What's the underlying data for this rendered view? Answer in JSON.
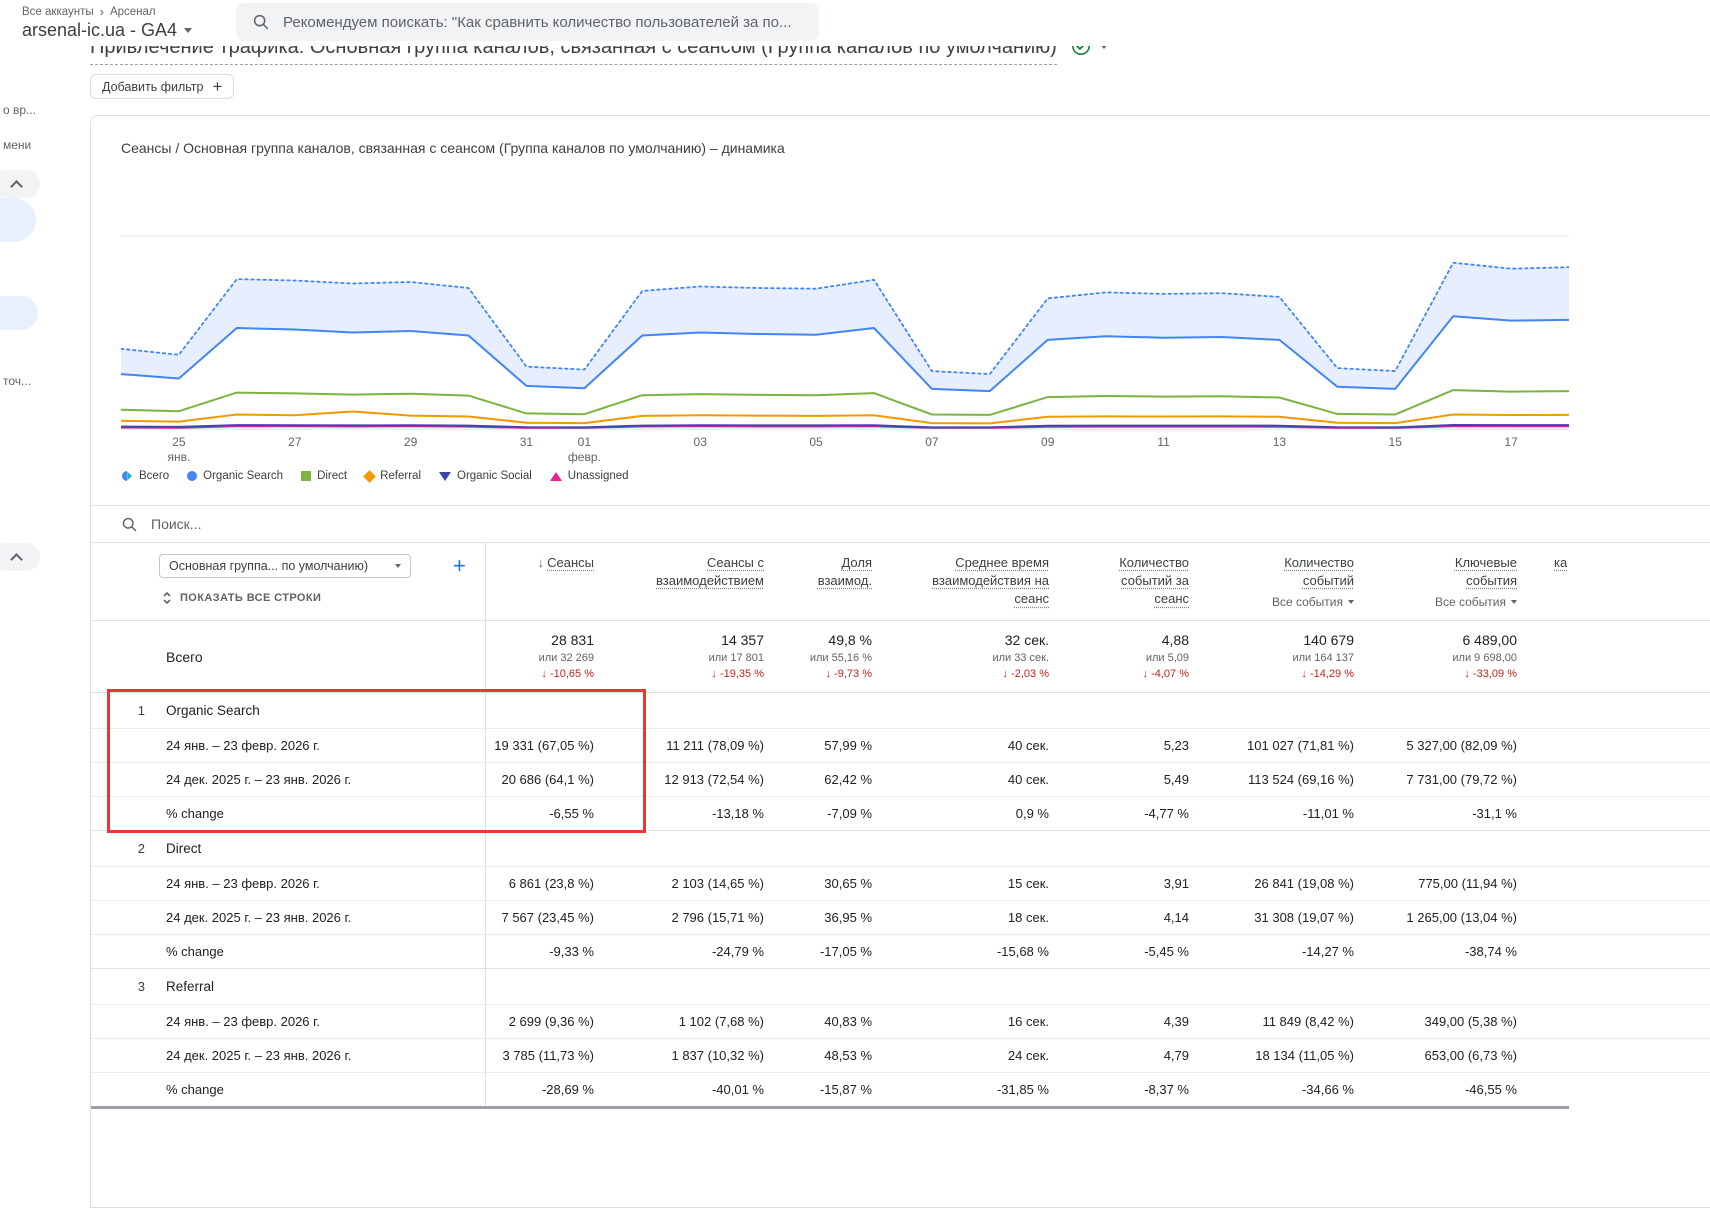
{
  "annotation": {
    "color": "#e53935"
  },
  "topbar": {
    "breadcrumb": {
      "all_accounts": "Все аккаунты",
      "account": "Арсенал"
    },
    "property": "arsenal-ic.ua - GA4",
    "search_placeholder": "Рекомендуем поискать: \"Как сравнить количество пользователей за по..."
  },
  "sidebar": {
    "fragment1": "о вр...",
    "fragment2": "мени",
    "fragment3": "точ..."
  },
  "report": {
    "title": "Привлечение трафика: Основная группа каналов, связанная с сеансом (Группа каналов по умолчанию)",
    "add_filter": "Добавить фильтр"
  },
  "chart_data": {
    "type": "line",
    "title": "Сеансы / Основная группа каналов, связанная с сеансом (Группа каналов по умолчанию) – динамика",
    "ylim": [
      0,
      1300
    ],
    "grid": false,
    "legend_position": "bottom",
    "fill_color": "rgba(66,133,244,0.13)",
    "ticks": [
      {
        "i": 1,
        "line1": "25",
        "line2": "янв."
      },
      {
        "i": 3,
        "line1": "27"
      },
      {
        "i": 5,
        "line1": "29"
      },
      {
        "i": 7,
        "line1": "31"
      },
      {
        "i": 8,
        "line1": "01",
        "line2": "февр."
      },
      {
        "i": 10,
        "line1": "03"
      },
      {
        "i": 12,
        "line1": "05"
      },
      {
        "i": 14,
        "line1": "07"
      },
      {
        "i": 16,
        "line1": "09"
      },
      {
        "i": 18,
        "line1": "11"
      },
      {
        "i": 20,
        "line1": "13"
      },
      {
        "i": 22,
        "line1": "15"
      },
      {
        "i": 24,
        "line1": "17"
      }
    ],
    "series": [
      {
        "id": "total",
        "name": "Всего",
        "color": "#4285f4",
        "style": "dotted",
        "values": [
          540,
          500,
          1010,
          1000,
          980,
          990,
          950,
          420,
          400,
          930,
          960,
          950,
          945,
          1005,
          390,
          370,
          880,
          920,
          910,
          915,
          890,
          410,
          390,
          1120,
          1080,
          1090
        ]
      },
      {
        "id": "organic-search",
        "name": "Organic Search",
        "color": "#4285f4",
        "style": "solid",
        "values": [
          370,
          340,
          680,
          670,
          650,
          660,
          630,
          290,
          275,
          630,
          650,
          640,
          635,
          680,
          270,
          255,
          600,
          625,
          615,
          620,
          600,
          285,
          270,
          760,
          730,
          735
        ]
      },
      {
        "id": "direct",
        "name": "Direct",
        "color": "#7cb342",
        "style": "solid",
        "values": [
          130,
          120,
          245,
          240,
          232,
          238,
          225,
          105,
          100,
          228,
          235,
          230,
          228,
          242,
          98,
          95,
          215,
          222,
          218,
          220,
          212,
          102,
          98,
          262,
          252,
          255
        ]
      },
      {
        "id": "referral",
        "name": "Referral",
        "color": "#f29900",
        "style": "solid",
        "values": [
          55,
          50,
          98,
          92,
          118,
          90,
          84,
          42,
          40,
          88,
          92,
          90,
          88,
          92,
          40,
          38,
          82,
          85,
          84,
          85,
          82,
          42,
          40,
          98,
          94,
          95
        ]
      },
      {
        "id": "organic-social",
        "name": "Organic Social",
        "color": "#3949ab",
        "style": "solid",
        "values": [
          16,
          14,
          26,
          25,
          24,
          25,
          23,
          12,
          11,
          23,
          25,
          24,
          24,
          25,
          11,
          11,
          22,
          23,
          23,
          23,
          22,
          12,
          11,
          27,
          26,
          26
        ]
      },
      {
        "id": "unassigned",
        "name": "Unassigned",
        "color": "#e52592",
        "style": "solid",
        "values": [
          10,
          9,
          19,
          18,
          17,
          18,
          16,
          8,
          8,
          17,
          18,
          17,
          17,
          18,
          8,
          8,
          15,
          16,
          16,
          16,
          15,
          8,
          8,
          19,
          18,
          18
        ]
      }
    ]
  },
  "legend": {
    "items": [
      {
        "id": "total",
        "label": "Всего",
        "icon": "total",
        "color": "#4285f4"
      },
      {
        "id": "organic-search",
        "label": "Organic Search",
        "icon": "circle",
        "color": "#4285f4"
      },
      {
        "id": "direct",
        "label": "Direct",
        "icon": "square",
        "color": "#7cb342"
      },
      {
        "id": "referral",
        "label": "Referral",
        "icon": "diamond",
        "color": "#f29900"
      },
      {
        "id": "organic-social",
        "label": "Organic Social",
        "icon": "triangle-down",
        "color": "#3949ab"
      },
      {
        "id": "unassigned",
        "label": "Unassigned",
        "icon": "triangle-up",
        "color": "#e52592"
      }
    ]
  },
  "table": {
    "search_placeholder": "Поиск...",
    "dimension_dropdown": "Основная группа... по умолчанию)",
    "show_all_rows": "ПОКАЗАТЬ ВСЕ СТРОКИ",
    "headers": {
      "sessions": "Сеансы",
      "engaged_sessions": "Сеансы с\nвзаимодействием",
      "engagement_rate": "Доля\nвзаимод.",
      "avg_engagement_time": "Среднее время\nвзаимодействия на\nсеанс",
      "events_per_session": "Количество\nсобытий за\nсеанс",
      "event_count": "Количество\nсобытий",
      "key_events": "Ключевые\nсобытия",
      "cut": "ка",
      "all_events_filter": "Все события"
    },
    "totals": {
      "label": "Всего",
      "cells": [
        {
          "value": "28 831",
          "alt": "или 32 269",
          "change": "-10,65 %"
        },
        {
          "value": "14 357",
          "alt": "или 17 801",
          "change": "-19,35 %"
        },
        {
          "value": "49,8 %",
          "alt": "или 55,16 %",
          "change": "-9,73 %"
        },
        {
          "value": "32 сек.",
          "alt": "или 33 сек.",
          "change": "-2,03 %"
        },
        {
          "value": "4,88",
          "alt": "или 5,09",
          "change": "-4,07 %"
        },
        {
          "value": "140 679",
          "alt": "или 164 137",
          "change": "-14,29 %"
        },
        {
          "value": "6 489,00",
          "alt": "или 9 698,00",
          "change": "-33,09 %"
        }
      ]
    },
    "period1_label": "24 янв. – 23 февр. 2026 г.",
    "period2_label": "24 дек. 2025 г. – 23 янв. 2026 г.",
    "change_label": "% change",
    "rows": [
      {
        "id": "organic-search",
        "index": "1",
        "name": "Organic Search",
        "period1": [
          "19 331 (67,05 %)",
          "11 211 (78,09 %)",
          "57,99 %",
          "40 сек.",
          "5,23",
          "101 027 (71,81 %)",
          "5 327,00 (82,09 %)"
        ],
        "period2": [
          "20 686 (64,1 %)",
          "12 913 (72,54 %)",
          "62,42 %",
          "40 сек.",
          "5,49",
          "113 524 (69,16 %)",
          "7 731,00 (79,72 %)"
        ],
        "change": [
          "-6,55 %",
          "-13,18 %",
          "-7,09 %",
          "0,9 %",
          "-4,77 %",
          "-11,01 %",
          "-31,1 %"
        ]
      },
      {
        "id": "direct",
        "index": "2",
        "name": "Direct",
        "period1": [
          "6 861 (23,8 %)",
          "2 103 (14,65 %)",
          "30,65 %",
          "15 сек.",
          "3,91",
          "26 841 (19,08 %)",
          "775,00 (11,94 %)"
        ],
        "period2": [
          "7 567 (23,45 %)",
          "2 796 (15,71 %)",
          "36,95 %",
          "18 сек.",
          "4,14",
          "31 308 (19,07 %)",
          "1 265,00 (13,04 %)"
        ],
        "change": [
          "-9,33 %",
          "-24,79 %",
          "-17,05 %",
          "-15,68 %",
          "-5,45 %",
          "-14,27 %",
          "-38,74 %"
        ]
      },
      {
        "id": "referral",
        "index": "3",
        "name": "Referral",
        "period1": [
          "2 699 (9,36 %)",
          "1 102 (7,68 %)",
          "40,83 %",
          "16 сек.",
          "4,39",
          "11 849 (8,42 %)",
          "349,00 (5,38 %)"
        ],
        "period2": [
          "3 785 (11,73 %)",
          "1 837 (10,32 %)",
          "48,53 %",
          "24 сек.",
          "4,79",
          "18 134 (11,05 %)",
          "653,00 (6,73 %)"
        ],
        "change": [
          "-28,69 %",
          "-40,01 %",
          "-15,87 %",
          "-31,85 %",
          "-8,37 %",
          "-34,66 %",
          "-46,55 %"
        ]
      }
    ]
  }
}
